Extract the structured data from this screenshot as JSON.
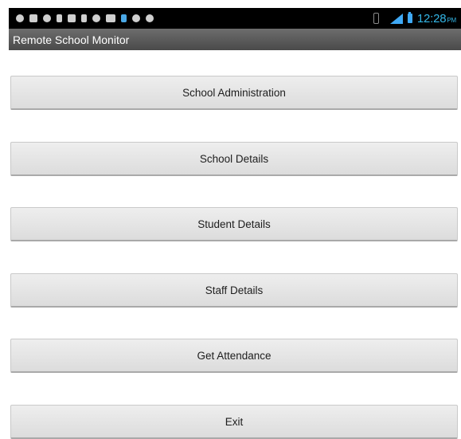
{
  "status_bar": {
    "notification_icons": [
      "android-icon",
      "image-icon",
      "phone-icon",
      "sd-card-icon",
      "download-icon",
      "clipboard-icon",
      "android-icon",
      "chat-icon",
      "bluetooth-icon",
      "settings-icon",
      "usb-icon"
    ],
    "right_icons": [
      "vibrate-icon",
      "signal-icon",
      "battery-icon"
    ],
    "time": "12:28",
    "ampm": "PM",
    "clock_color": "#33b5e5"
  },
  "app": {
    "title": "Remote School Monitor"
  },
  "menu": {
    "buttons": [
      {
        "label": "School Administration"
      },
      {
        "label": "School Details"
      },
      {
        "label": "Student Details"
      },
      {
        "label": "Staff Details"
      },
      {
        "label": "Get Attendance"
      },
      {
        "label": "Exit"
      }
    ]
  }
}
